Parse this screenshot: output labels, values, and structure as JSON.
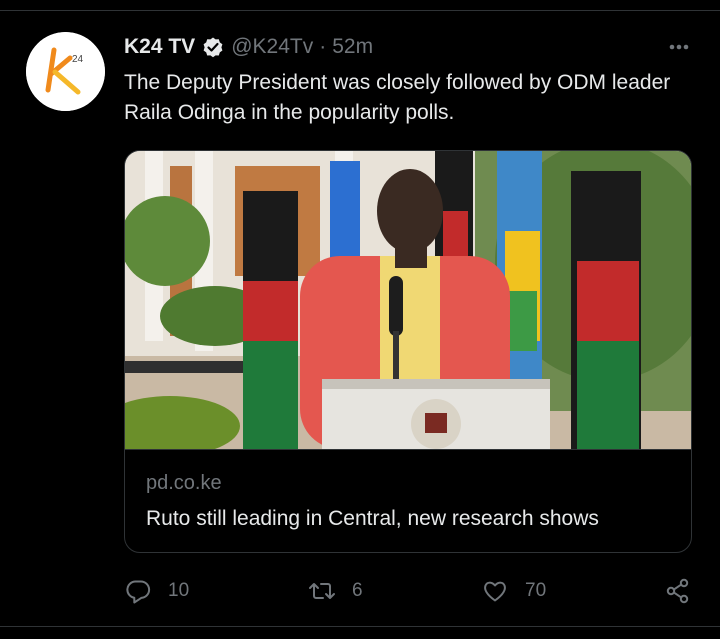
{
  "tweet": {
    "display_name": "K24 TV",
    "handle": "@K24Tv",
    "separator": "·",
    "time": "52m",
    "text": "The Deputy President was closely followed by ODM leader Raila Odinga in the popularity polls.",
    "verified": true,
    "icons": {
      "avatar": "k24-logo",
      "verified": "verified-badge-icon",
      "more": "more-options-icon"
    }
  },
  "card": {
    "domain": "pd.co.ke",
    "title": "Ruto still leading in Central, new research shows",
    "image_description_icon": "news-photo"
  },
  "actions": {
    "reply_count": "10",
    "retweet_count": "6",
    "like_count": "70",
    "icons": [
      "reply-icon",
      "retweet-icon",
      "like-icon",
      "share-icon"
    ]
  },
  "colors": {
    "background": "#000000",
    "text_primary": "#e7e9ea",
    "text_secondary": "#71767b",
    "border": "#2f3336",
    "logo_orange": "#f08a1c"
  }
}
